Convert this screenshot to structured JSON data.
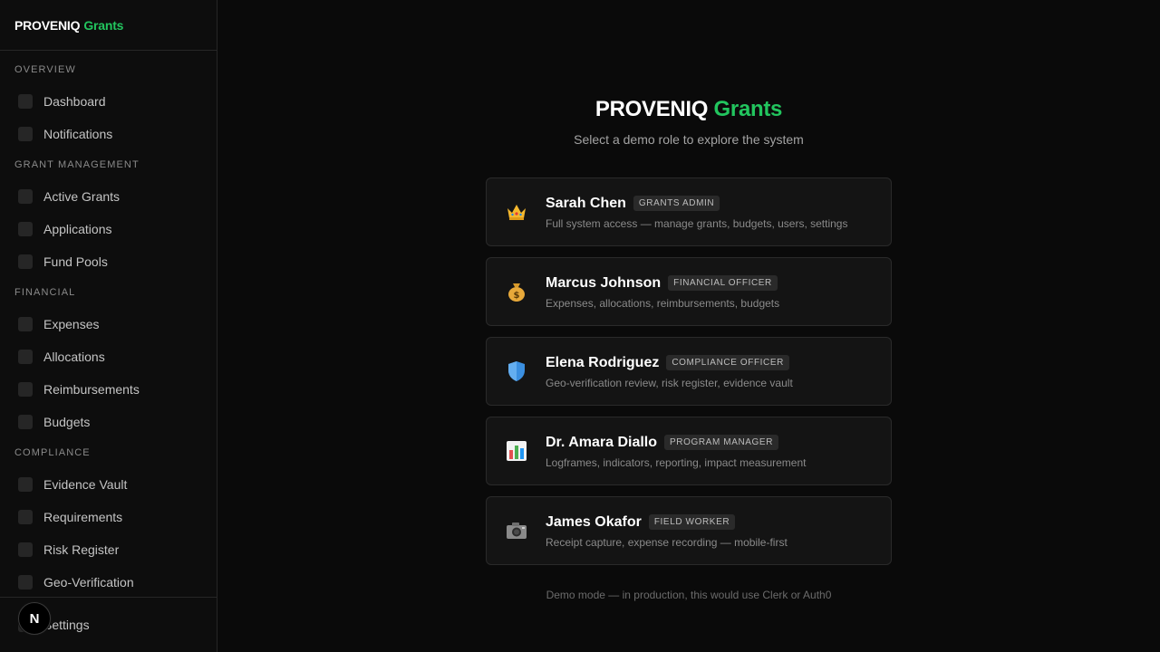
{
  "brand": {
    "name": "PROVENIQ",
    "product": "Grants"
  },
  "sidebar": {
    "sections": [
      {
        "title": "OVERVIEW",
        "items": [
          {
            "label": "Dashboard"
          },
          {
            "label": "Notifications"
          }
        ]
      },
      {
        "title": "GRANT MANAGEMENT",
        "items": [
          {
            "label": "Active Grants"
          },
          {
            "label": "Applications"
          },
          {
            "label": "Fund Pools"
          }
        ]
      },
      {
        "title": "FINANCIAL",
        "items": [
          {
            "label": "Expenses"
          },
          {
            "label": "Allocations"
          },
          {
            "label": "Reimbursements"
          },
          {
            "label": "Budgets"
          }
        ]
      },
      {
        "title": "COMPLIANCE",
        "items": [
          {
            "label": "Evidence Vault"
          },
          {
            "label": "Requirements"
          },
          {
            "label": "Risk Register"
          },
          {
            "label": "Geo-Verification"
          }
        ]
      }
    ],
    "footer": {
      "label": "Settings"
    },
    "overlay_badge": "N"
  },
  "main": {
    "title": {
      "part1": "PROVENIQ",
      "part2": "Grants"
    },
    "subtitle": "Select a demo role to explore the system",
    "roles": [
      {
        "icon": "crown-icon",
        "name": "Sarah Chen",
        "role": "GRANTS ADMIN",
        "desc": "Full system access — manage grants, budgets, users, settings"
      },
      {
        "icon": "money-bag-icon",
        "name": "Marcus Johnson",
        "role": "FINANCIAL OFFICER",
        "desc": "Expenses, allocations, reimbursements, budgets"
      },
      {
        "icon": "shield-icon",
        "name": "Elena Rodriguez",
        "role": "COMPLIANCE OFFICER",
        "desc": "Geo-verification review, risk register, evidence vault"
      },
      {
        "icon": "bar-chart-icon",
        "name": "Dr. Amara Diallo",
        "role": "PROGRAM MANAGER",
        "desc": "Logframes, indicators, reporting, impact measurement"
      },
      {
        "icon": "camera-icon",
        "name": "James Okafor",
        "role": "FIELD WORKER",
        "desc": "Receipt capture, expense recording — mobile-first"
      }
    ],
    "footnote": "Demo mode — in production, this would use Clerk or Auth0"
  },
  "colors": {
    "accent": "#22c55e",
    "background": "#0a0a0a",
    "card": "#141414"
  }
}
